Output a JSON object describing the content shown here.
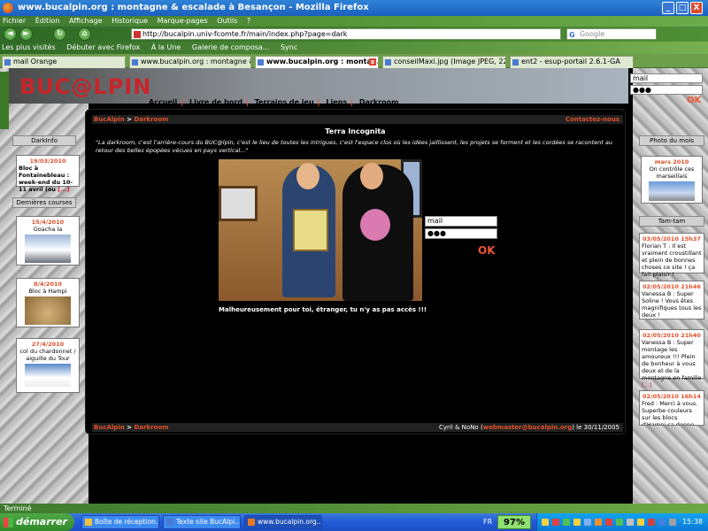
{
  "window": {
    "title": "www.bucalpin.org : montagne & escalade à Besançon - Mozilla Firefox",
    "min": "_",
    "max": "□",
    "close": "X"
  },
  "menu": [
    "Fichier",
    "Édition",
    "Affichage",
    "Historique",
    "Marque-pages",
    "Outils",
    "?"
  ],
  "nav": {
    "back": "◄",
    "forward": "►",
    "reload": "↻",
    "home": "⌂",
    "url": "http://bucalpin.univ-fcomte.fr/main/index.php?page=dark",
    "search_placeholder": "Google",
    "search_logo": "G"
  },
  "bookmarks": [
    "Les plus visités",
    "Débuter avec Firefox",
    "À la Une",
    "Galerie de composa...",
    "Sync"
  ],
  "tabs": [
    {
      "label": "mail Orange",
      "active": false
    },
    {
      "label": "www.bucalpin.org : montagne &...",
      "active": false
    },
    {
      "label": "www.bucalpin.org : montag...",
      "active": true
    },
    {
      "label": "conseilMaxi.jpg (Image JPEG, 22...",
      "active": false
    },
    {
      "label": "ent2 - esup-portail 2.6.1-GA",
      "active": false
    }
  ],
  "tab_close": "x",
  "site": {
    "logo": "BUC@LPIN",
    "nav": [
      "Accueil",
      "Livre de bord",
      "Terrains de jeu",
      "Liens",
      "Darkroom"
    ],
    "nav_sep": "|",
    "login": {
      "user_placeholder": "mail",
      "password_value": "●●●",
      "ok": "OK"
    }
  },
  "breadcrumb": {
    "home": "BucAlpin",
    "sep": ">",
    "page": "Darkroom",
    "contact": "Contactez-nous"
  },
  "page_title": "Terra Incognita",
  "intro": "\"La darkroom, c'est l'arrière-cours du BUC@lpin, c'est le lieu de toutes les intrigues, c'est l'espace clos où les idées jaillissent, les projets se forment et les cordées se racontent au retour des belles épopées vécues en pays vertical...\"",
  "warning": "Malheureusement pour toi, étranger, tu n'y as pas accès !!!",
  "footer": {
    "home": "BucAlpin",
    "sep": ">",
    "page": "Darkroom",
    "credit": "Cyril & NoNo (",
    "email": "webmaster@bucalpin.org",
    "date": ") le 30/11/2005"
  },
  "left": {
    "darkinfo_head": "DarkInfo",
    "darkinfo": {
      "date": "19/03/2010",
      "text": "Bloc à Fontainebleau : week-end du 10-11 avril (ou",
      "more": "[...]"
    },
    "courses_head": "Dernières courses",
    "courses": [
      {
        "date": "15/4/2010",
        "title": "Goacha la"
      },
      {
        "date": "8/4/2010",
        "title": "Bloc à Hampi"
      },
      {
        "date": "27/4/2010",
        "title": "col du chardonnet / aiguille du Tour"
      }
    ]
  },
  "right": {
    "photo_head": "Photo du mois",
    "photo": {
      "date": "mars 2010",
      "text": "On contrôle ces marseillais"
    },
    "tamtam_head": "Tam-tam",
    "messages": [
      {
        "date": "03/05/2010 15h37",
        "text": "Florian T : Il est vraiment croustillant et plein de bonnes choses ce site ! ça fait plaisir !"
      },
      {
        "date": "02/05/2010 21h46",
        "text": "Vanessa B : Super Soline ! Vous êtes magnifiques tous les deux !"
      },
      {
        "date": "02/05/2010 21h40",
        "text": "Vanessa B : Super montage les amoureux !!! Plein de bonheur à vous deux et de la montagne en famille",
        "more": "[...]"
      },
      {
        "date": "02/05/2010 16h14",
        "text": "Fred : Merci à vous. Superbe couleurs sur les blocs d'Hampi ça donne envie."
      }
    ]
  },
  "status": "Terminé",
  "taskbar": {
    "start": "démarrer",
    "tasks": [
      "Boîte de réception...",
      "Texte site BucAlpi...",
      "www.bucalpin.org..."
    ],
    "lang": "FR",
    "battery": "97%",
    "clock": "15:38"
  }
}
